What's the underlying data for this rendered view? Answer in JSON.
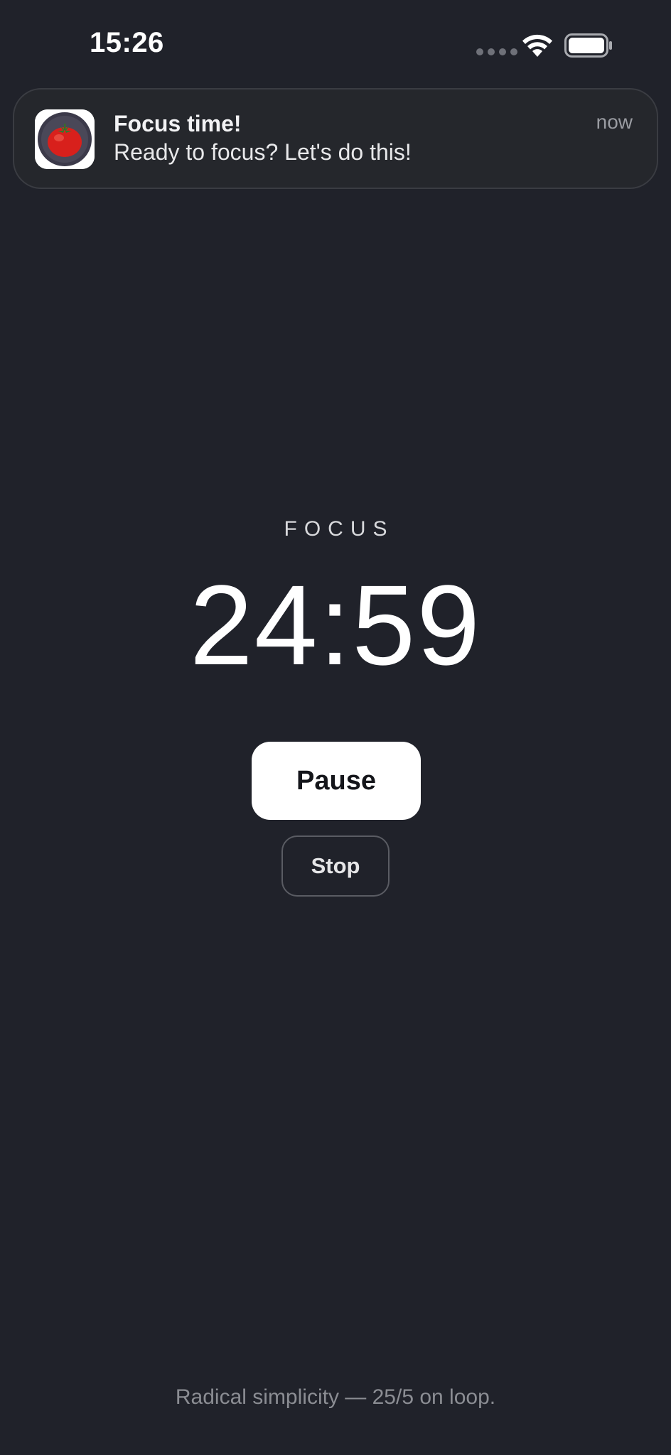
{
  "status_bar": {
    "time": "15:26",
    "wifi_icon": "wifi-icon",
    "battery_icon": "battery-icon"
  },
  "notification": {
    "app_icon": "tomato-icon",
    "title": "Focus time!",
    "body": "Ready to focus? Let's do this!",
    "time": "now"
  },
  "timer": {
    "mode_label": "FOCUS",
    "display": "24:59"
  },
  "controls": {
    "pause_label": "Pause",
    "stop_label": "Stop"
  },
  "footer": {
    "tagline": "Radical simplicity — 25/5 on loop."
  },
  "colors": {
    "background": "#20222a",
    "notification_bg": "#25272c",
    "primary_button_bg": "#ffffff",
    "text_primary": "#ffffff",
    "text_muted": "#8b8d93"
  }
}
